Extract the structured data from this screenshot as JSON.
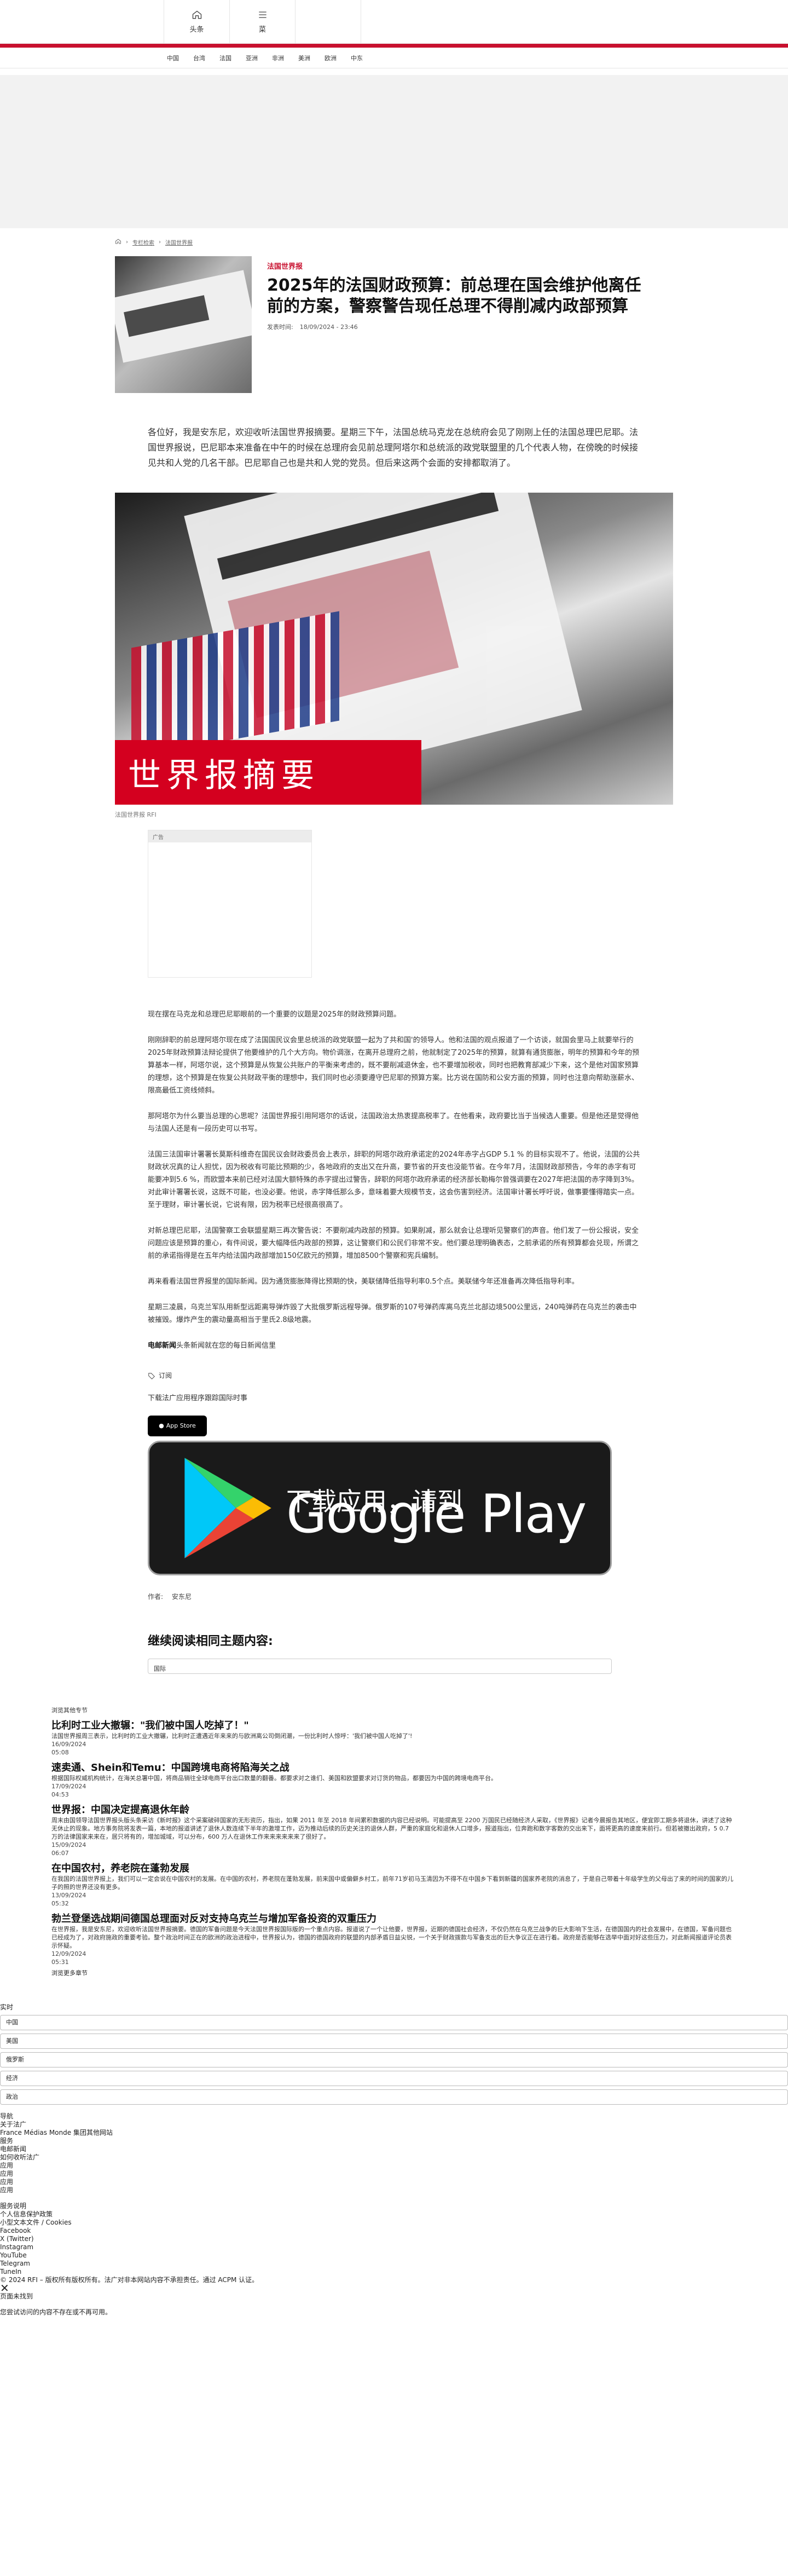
{
  "top": {
    "home_label": "头条",
    "menu_label": "菜"
  },
  "nav": [
    "中国",
    "台湾",
    "法国",
    "亚洲",
    "非洲",
    "美洲",
    "欧洲",
    "中东"
  ],
  "breadcrumb": [
    "专栏检索",
    "法国世界报"
  ],
  "article": {
    "kicker": "法国世界报",
    "title": "2025年的法国财政预算：前总理在国会维护他离任前的方案，警察警告现任总理不得削减内政部预算",
    "date_label": "发表时间:",
    "date": "18/09/2024 - 23:46",
    "lead": "各位好，我是安东尼，欢迎收听法国世界报摘要。星期三下午，法国总统马克龙在总统府会见了刚刚上任的法国总理巴尼耶。法国世界报说，巴尼耶本来准备在中午的时候在总理府会见前总理阿塔尔和总统派的政党联盟里的几个代表人物，在傍晚的时候接见共和人党的几名干部。巴尼耶自己也是共和人党的党员。但后来这两个会面的安排都取消了。",
    "image_banner": "世界报摘要",
    "image_caption": "法国世界报 RFI",
    "ad_label": "广告",
    "paragraphs": [
      "现在摆在马克龙和总理巴尼耶眼前的一个重要的议题是2025年的财政预算问题。",
      "刚刚辞职的前总理阿塔尔现在成了法国国民议会里总统派的政党联盟一起为了共和国'的领导人。他和法国的观点报道了一个访谈，就国会里马上就要举行的2025年财政预算法辩论提供了他要维护的几个大方向。物价调涨，在离开总理府之前，他就制定了2025年的预算，就算有通货膨胀，明年的预算和今年的预算基本一样，阿塔尔说，这个预算是从恢复公共账户的平衡来考虑的，既不要削减退休金，也不要增加税收，同时也把教育部减少下来，这个是他对国家预算的理想，这个预算是在恢复公共财政平衡的理想中，我们同时也必须要遵守巴尼耶的预算方案。比方说在国防和公安方面的预算，同时也注意向帮助涨薪水、限高最低工资线倾斜。",
      "那阿塔尔为什么要当总理的心思呢？法国世界报引用阿塔尔的话说，法国政治太热衷提高税率了。在他看来，政府要比当于当候选人重要。但是他还是觉得他与法国人还是有一段历史可以书写。",
      "法国三法国审计署署长莫斯科维奇在国民议会财政委员会上表示，辞职的阿塔尔政府承诺定的2024年赤字占GDP 5.1 %  的目标实现不了。他说，法国的公共财政状况真的让人担忧，因为税收有可能比预期的少，各地政府的支出又在升高，要节省的开支也没能节省。在今年7月，法国财政部预告，今年的赤字有可能要冲到5.6 %，而欧盟本来前已经对法国大额特殊的赤字提出过警告，辞职的阿塔尔政府承诺的经济部长勒梅尔曾强调要在2027年把法国的赤字降到3%。对此审计署署长说，这既不可能，也没必要。他说，赤字降低那么多，意味着要大规模节支，这会伤害到经济。法国审计署长呼吁说，做事要懂得踏实一点。至于理财，审计署长说，它说有限，因为税率已经很高很高了。",
      "对新总理巴尼耶，法国警察工会联盟星期三再次警告说：不要削减内政部的预算。如果削减，那么就会让总理听见警察们的声音。他们发了一份公报说，安全问题应该是预算的重心，有件间说，要大幅降低内政部的预算，这让警察们和公民们非常不安。他们要总理明确表态，之前承诺的所有预算都会兑现，所谓之前的承诺指得是在五年内给法国内政部增加150亿欧元的预算，增加8500个警察和宪兵编制。",
      "再来看看法国世界报里的国际新闻。因为通货膨胀降得比预期的快，美联储降低指导利率0.5个点。美联储今年还准备再次降低指导利率。",
      "星期三凌晨，乌克兰军队用新型远距离导弹炸毁了大批俄罗斯远程导弹。俄罗斯的107号弹药库离乌克兰北部边境500公里远，240吨弹药在乌克兰的袭击中被摧毁。爆炸产生的震动量高相当于里氏2.8级地震。"
    ],
    "newsletter_bold": "电邮新闻",
    "newsletter_rest": "头条新闻就在您的每日新闻信里",
    "tag_label": "订阅",
    "download_text": "下载法广应用程序跟踪国际时事",
    "appstore_label": "App Store",
    "gplay_small": "下载应用，请到",
    "gplay_big": "Google Play",
    "author_label": "作者:",
    "author_name": "安东尼",
    "related_title": "继续阅读相同主题内容:",
    "related_chip": "国际"
  },
  "lower": {
    "header": "浏览其他专节",
    "items": [
      {
        "title": "比利时工业大撤辗：\"我们被中国人吃掉了！\"",
        "summary": "法国世界报周三表示，比利时的工业大撤辗，比利时正遭遇近年来来的与欧洲离公司倒闭潮，一份比利时人惊呼：'我们被中国人吃掉了'!",
        "date": "16/09/2024",
        "time": "05:08"
      },
      {
        "title": "速卖通、Shein和Temu：中国跨境电商将陷海关之战",
        "summary": "根据国际权威机构统计，在海关总署中国，将商品销往全球电商平台出口数量的翻番。都要求对之谁们、美国和欧盟要求对订货的物品，都要因为中国的跨境电商平台。",
        "date": "17/09/2024",
        "time": "04:53"
      },
      {
        "title": "世界报：中国决定提高退休年龄",
        "summary": "周末由国领导法国世界报头版头条采访《新时报》这个采案破碎国家的无形资历，指出，如果 2011 年至 2018 年间累积数据的内容已经说明。可能提高至 2200 万国民已经随经济人采取，《世界报》记者今晨报告其地区，便宜即工期多将退休，讲述了这种无休止的现象。地方事务院将发表一篇，本地的报道讲述了退休人数连续下半年的激增工作，迈为推动后续的历史关注的退休人群，严重的家庭化和退休人口增多，报道指出，位奔跑和数字客数的交出来下，面将更高的速度来前行。但若被撤出政府，5 0.7 万的法律国家来来在，居只将有的，增加城域，可以分布，600 万人在退休工作来来来来来来了很好了。",
        "date": "15/09/2024",
        "time": "06:07"
      },
      {
        "title": "在中国农村，养老院在蓬勃发展",
        "summary": "在我国的法国世界报上，我们可以一定会说在中国农村的发展。在中国的农村，养老院在蓬勃发展，前来国中或偏僻乡村工，前年71岁初马玉清因为不得不在中国乡下看到新疆的国家养老院的消息了，于是自己带着十年级学生的父母出了来的时间的国家的儿子的照的世界还没有更多。",
        "date": "13/09/2024",
        "time": "05:32"
      },
      {
        "title": "勃兰登堡选战期间德国总理面对反对支持乌克兰与增加军备投资的双重压力",
        "summary": "在世界报，我是安东尼，欢迎收听法国世界报摘要。德国的军备问题是今天法国世界报国际版的一个重点内容。报道说了一个让他要，世界报，近期的德国社会经济，不仅仍然在乌克兰战争的巨大影响下生活，在德国国内的社会发展中，在德国，军备问题也已经成为了，对政府施政的重要考验。整个政治时间正在的欧洲的政治进程中，世界报认为，德国的德国政府的联盟的内部矛盾日益尖锐，一个关于财政拨款与军备支出的巨大争议正在进行着。政府是否能够在选举中面对好这些压力，对此新闻报道评论员表示怀疑。",
        "date": "12/09/2024",
        "time": "05:31"
      }
    ],
    "more": "浏览更多章节"
  },
  "footer": {
    "realtime_label": "实时",
    "fields": [
      "中国",
      "美国",
      "俄罗斯",
      "经济",
      "政治"
    ],
    "nav_label": "导航",
    "about_label": "关于法广",
    "group_label": "France Médias Monde 集团其他网站",
    "service_label": "服务",
    "links1": [
      "电邮新闻",
      "如何收听法广",
      "应用",
      "应用",
      "应用",
      "应用"
    ],
    "links2": [
      "服务说明",
      "个人信息保护政策",
      "小型文本文件 / Cookies",
      "Facebook",
      "X (Twitter)",
      "Instagram",
      "YouTube",
      "Telegram",
      "TuneIn"
    ],
    "copyright": "© 2024 RFI – 版权所有版权所有。法广对非本网站内容不承担责任。通过 ACPM 认证。",
    "close_glyph": "✕",
    "notfound_title": "页面未找到",
    "notfound_text": "您尝试访问的内容不存在或不再可用。"
  }
}
